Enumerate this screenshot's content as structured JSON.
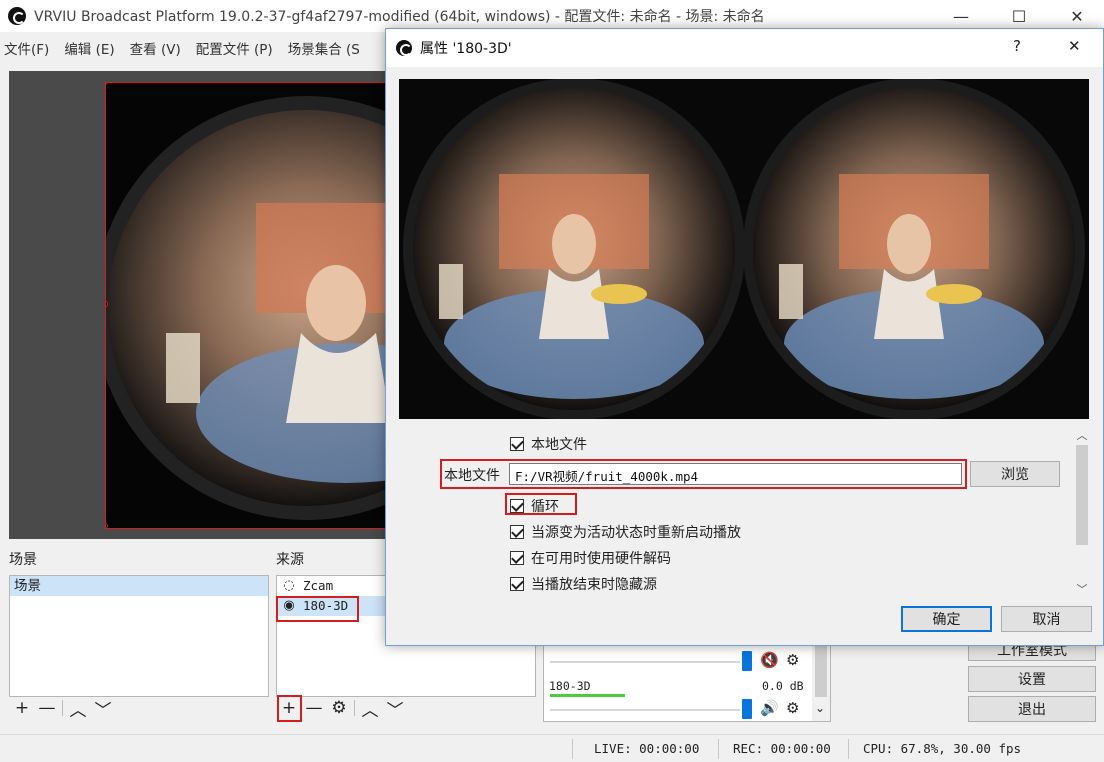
{
  "window": {
    "title": "VRVIU Broadcast Platform 19.0.2-37-gf4af2797-modified (64bit, windows) - 配置文件: 未命名 - 场景: 未命名",
    "minimize": "—",
    "maximize": "☐",
    "close": "✕"
  },
  "menu": [
    "文件(F)",
    "编辑 (E)",
    "查看 (V)",
    "配置文件 (P)",
    "场景集合 (S"
  ],
  "scenes": {
    "label": "场景",
    "items": [
      "场景"
    ]
  },
  "sources": {
    "label": "来源",
    "items": [
      {
        "name": "Zcam",
        "icon": "eye-hidden-icon",
        "glyph": "◌"
      },
      {
        "name": "180-3D",
        "icon": "eye-icon",
        "glyph": "◉"
      }
    ]
  },
  "toolbar_glyphs": {
    "add": "+",
    "remove": "—",
    "settings": "⚙",
    "up": "︿",
    "down": "﹀"
  },
  "mixer": {
    "channel_name": "180-3D",
    "channel_level": "0.0 dB",
    "mute_glyph": "🔇",
    "volume_glyph": "🔊",
    "gear_glyph": "⚙",
    "scroll_down": "⌄"
  },
  "controls": {
    "studio_mode": "工作室模式",
    "settings": "设置",
    "exit": "退出"
  },
  "status": {
    "live": "LIVE: 00:00:00",
    "rec": "REC: 00:00:00",
    "cpu": "CPU: 67.8%, 30.00 fps"
  },
  "dialog": {
    "title": "属性 '180-3D'",
    "help": "?",
    "close": "✕",
    "local_file_check": "本地文件",
    "local_file_label": "本地文件",
    "local_file_path": "F:/VR视频/fruit_4000k.mp4",
    "browse": "浏览",
    "options": [
      {
        "label": "循环",
        "checked": true
      },
      {
        "label": "当源变为活动状态时重新启动播放",
        "checked": true
      },
      {
        "label": "在可用时使用硬件解码",
        "checked": true
      },
      {
        "label": "当播放结束时隐藏源",
        "checked": true
      }
    ],
    "ok": "确定",
    "cancel": "取消",
    "scroll_up": "︿",
    "scroll_down": "﹀"
  }
}
